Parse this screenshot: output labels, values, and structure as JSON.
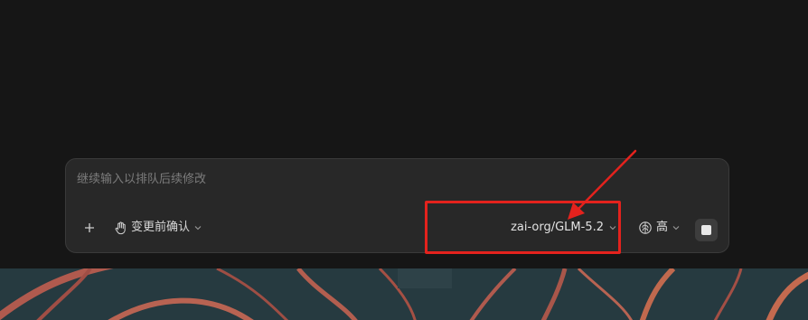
{
  "composer": {
    "placeholder": "继续输入以排队后续修改",
    "approval_label": "变更前确认",
    "model_label": "zai-org/GLM-5.2",
    "effort_label": "高"
  },
  "icons": {
    "add": "plus-icon",
    "approval": "hand-icon",
    "approval_chevron": "chevron-down-icon",
    "model_chevron": "chevron-down-icon",
    "effort": "brain-icon",
    "effort_chevron": "chevron-down-icon",
    "stop": "stop-icon"
  },
  "colors": {
    "background": "#161616",
    "composer_bg": "#282828",
    "annotation": "#e4221d",
    "wallpaper": "#263a40"
  }
}
